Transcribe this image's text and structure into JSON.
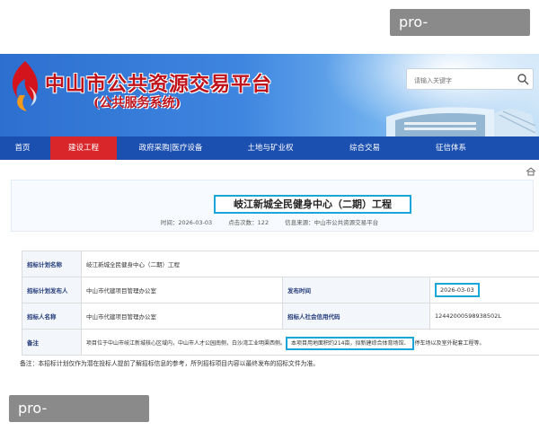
{
  "watermark": {
    "top": "pro-sportlive.com",
    "bottom": "pro-sportlive.com"
  },
  "header": {
    "site_title": "中山市公共资源交易平台",
    "site_subtitle": "(公共服务系统)",
    "search_placeholder": "请输入关键字"
  },
  "nav": {
    "items": [
      {
        "label": "首页"
      },
      {
        "label": "建设工程"
      },
      {
        "label": "政府采购|医疗设备"
      },
      {
        "label": "土地与矿业权"
      },
      {
        "label": "综合交易"
      },
      {
        "label": "征信体系"
      }
    ],
    "active_index": 1
  },
  "project": {
    "title": "岐江新城全民健身中心（二期）工程",
    "time_label": "时间：",
    "time": "2026-03-03",
    "views_label": "点击次数：",
    "views": "122",
    "source_label": "信息来源：",
    "source": "中山市公共资源交易平台"
  },
  "table": {
    "plan_name_label": "招标计划名称",
    "plan_name": "岐江新城全民健身中心（二期）工程",
    "publisher_label": "招标计划发布人",
    "publisher": "中山市代建项目管理办公室",
    "publish_time_label": "发布时间",
    "publish_time": "2026-03-03",
    "tenderer_label": "招标人名称",
    "tenderer": "中山市代建项目管理办公室",
    "credit_code_label": "招标人社会信用代码",
    "credit_code": "12442000598938502L",
    "remark_label": "备注",
    "remark_part1": "项目位于中山市岐江新城核心区域内，中山市人才公园南侧，白沙湾工业明渠西侧。",
    "remark_highlight": "本项目用地面积约214亩，拟新建综合体育场馆、",
    "remark_part2": "停车场以及室外配套工程等。"
  },
  "footnote": "备注：本招标计划仅作为潜在投标人提前了解招标信息的参考，所列招标项目内容以最终发布的招标文件为准。",
  "colors": {
    "nav_bg": "#1b4fb0",
    "nav_active": "#d8262b",
    "highlight_border": "#1aa6d9",
    "title_red": "#c0121b"
  }
}
